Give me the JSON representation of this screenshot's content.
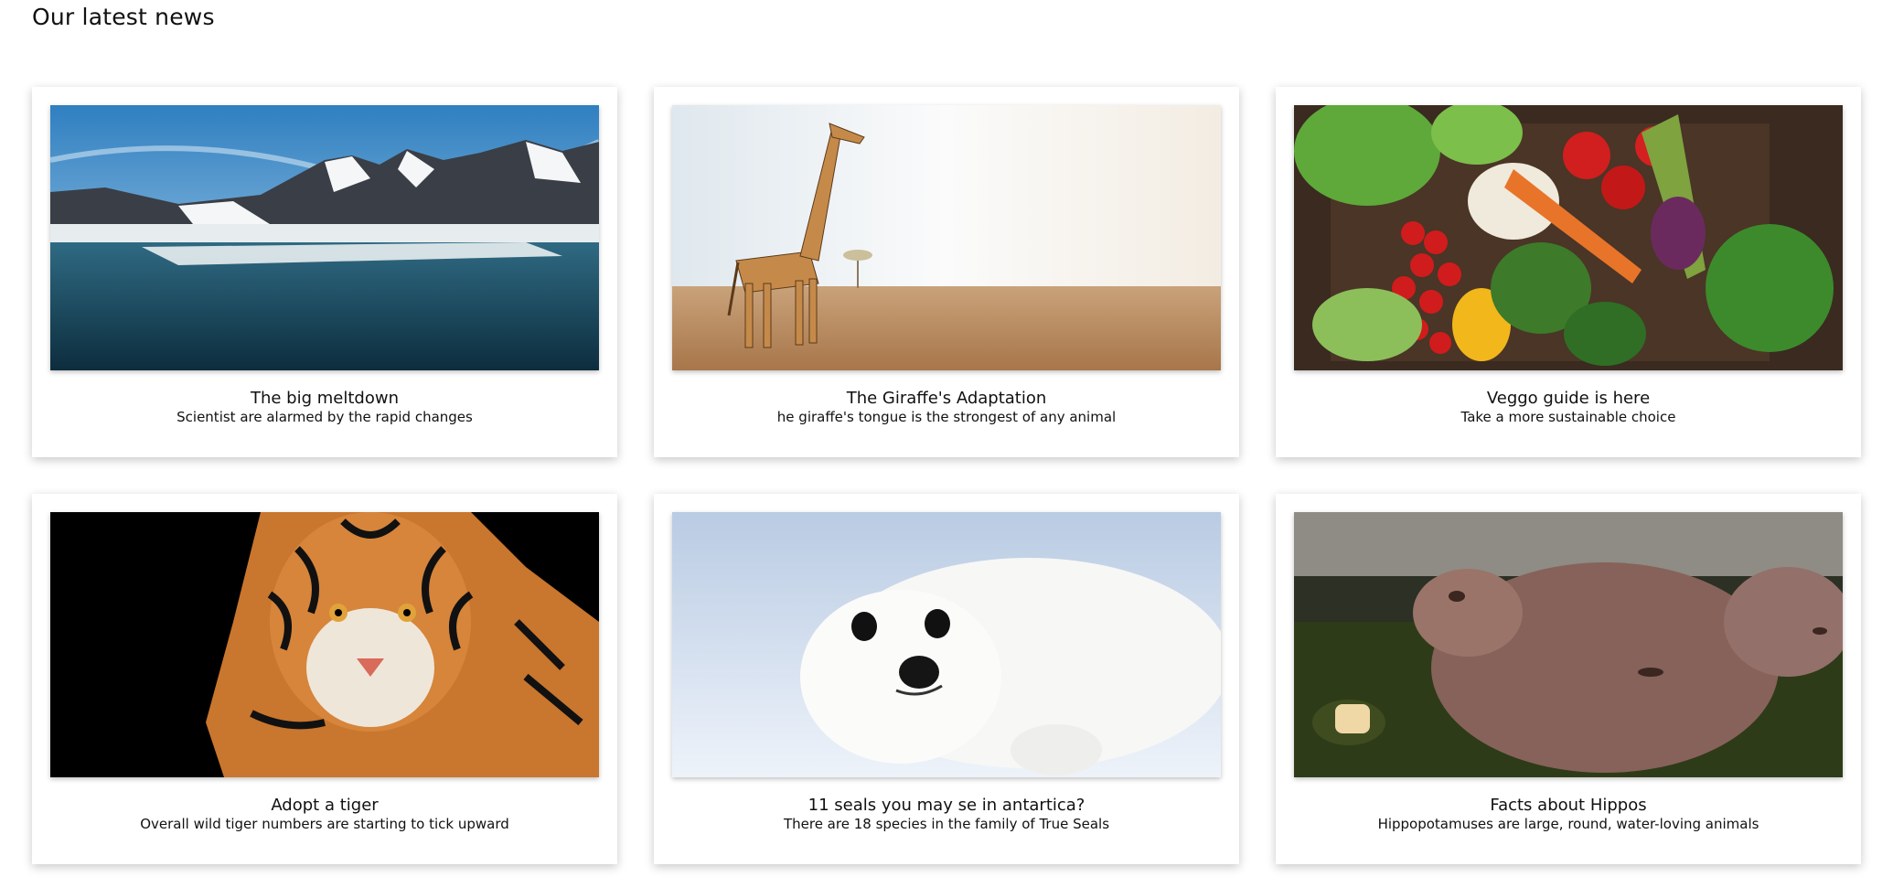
{
  "page": {
    "section_title": "Our latest news"
  },
  "cards": [
    {
      "title": "The big meltdown",
      "subtitle": "Scientist are alarmed by the rapid changes",
      "image": "glacier-lake-photo"
    },
    {
      "title": "The Giraffe's Adaptation",
      "subtitle": "he giraffe's tongue is the strongest of any animal",
      "image": "giraffe-savanna-photo"
    },
    {
      "title": "Veggo guide is here",
      "subtitle": "Take a more sustainable choice",
      "image": "vegetable-basket-photo"
    },
    {
      "title": "Adopt a tiger",
      "subtitle": "Overall wild tiger numbers are starting to tick upward",
      "image": "tiger-portrait-photo"
    },
    {
      "title": "11 seals you may se in antartica?",
      "subtitle": "There are 18 species in the family of True Seals",
      "image": "seal-pup-photo"
    },
    {
      "title": "Facts about Hippos",
      "subtitle": "Hippopotamuses are large, round, water-loving animals",
      "image": "hippo-water-photo"
    }
  ]
}
